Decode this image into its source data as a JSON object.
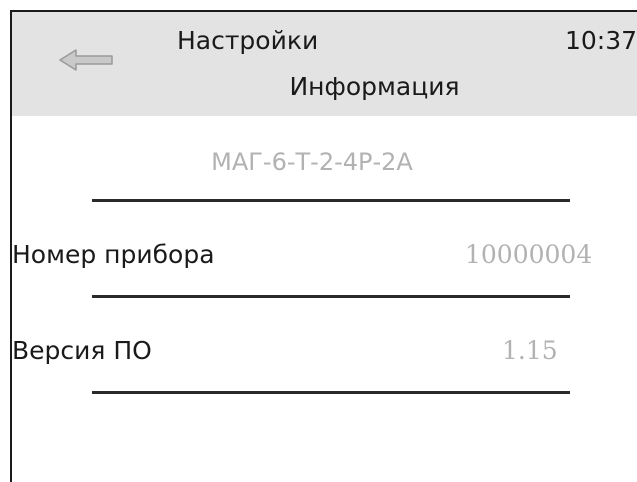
{
  "header": {
    "back_icon": "left-arrow-icon",
    "title": "Настройки",
    "time": "10:37",
    "subtitle": "Информация"
  },
  "device": {
    "model": "МАГ-6-Т-2-4Р-2А"
  },
  "info_rows": [
    {
      "label": "Номер прибора",
      "value": "10000004"
    },
    {
      "label": "Версия ПО",
      "value": "1.15"
    }
  ],
  "colors": {
    "header_bg": "#e3e3e3",
    "value_text": "#b2b2b2",
    "icon_fill": "#c9c9c9"
  }
}
